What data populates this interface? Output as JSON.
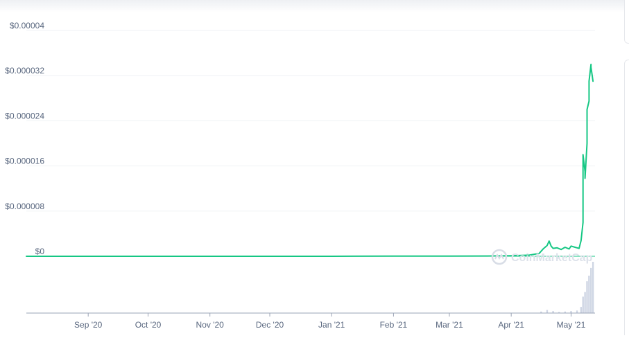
{
  "chart_data": {
    "type": "line",
    "watermark": "CoinMarketCap",
    "y_ticks": [
      "$0",
      "$0.000008",
      "$0.000016",
      "$0.000024",
      "$0.000032",
      "$0.00004"
    ],
    "y_tick_values": [
      0,
      8e-06,
      1.6e-05,
      2.4e-05,
      3.2e-05,
      4e-05
    ],
    "ylim": [
      0,
      4e-05
    ],
    "x_ticks": [
      {
        "label": "Sep '20",
        "date": "2020-09-01"
      },
      {
        "label": "Oct '20",
        "date": "2020-10-01"
      },
      {
        "label": "Nov '20",
        "date": "2020-11-01"
      },
      {
        "label": "Dec '20",
        "date": "2020-12-01"
      },
      {
        "label": "Jan '21",
        "date": "2021-01-01"
      },
      {
        "label": "Feb '21",
        "date": "2021-02-01"
      },
      {
        "label": "Mar '21",
        "date": "2021-03-01"
      },
      {
        "label": "Apr '21",
        "date": "2021-04-01"
      },
      {
        "label": "May '21",
        "date": "2021-05-01"
      }
    ],
    "xlim": [
      "2020-08-01",
      "2021-05-13"
    ],
    "grid": true,
    "colors": {
      "price_line": "#16c784",
      "volume": "#cfd6e4",
      "grid": "#eff2f5",
      "axis_text": "#58667e",
      "baseline": "#9aa3b5"
    },
    "series": [
      {
        "kind": "price",
        "x": [
          "2020-08-01",
          "2020-10-01",
          "2021-01-01",
          "2021-02-01",
          "2021-03-01",
          "2021-03-20",
          "2021-04-01",
          "2021-04-10",
          "2021-04-15",
          "2021-04-17",
          "2021-04-19",
          "2021-04-20",
          "2021-04-21",
          "2021-04-22",
          "2021-04-24",
          "2021-04-26",
          "2021-04-28",
          "2021-04-30",
          "2021-05-01",
          "2021-05-03",
          "2021-05-04",
          "2021-05-05",
          "2021-05-06",
          "2021-05-07",
          "2021-05-07",
          "2021-05-08",
          "2021-05-08",
          "2021-05-09",
          "2021-05-09",
          "2021-05-10",
          "2021-05-10",
          "2021-05-11",
          "2021-05-11",
          "2021-05-12"
        ],
        "y": [
          5e-10,
          1e-09,
          5e-09,
          2e-08,
          4e-08,
          5e-08,
          1e-07,
          2e-07,
          5e-07,
          1.3e-06,
          1.9e-06,
          2.7e-06,
          1.8e-06,
          1.4e-06,
          1.5e-06,
          1.2e-06,
          1.6e-06,
          1.3e-06,
          1.8e-06,
          1.6e-06,
          1.5e-06,
          1.4e-06,
          2.8e-06,
          6e-06,
          1.8e-05,
          1.5e-05,
          1.38e-05,
          2e-05,
          2.6e-05,
          2.75e-05,
          3.1e-05,
          3.4e-05,
          3.35e-05,
          3.1e-05
        ]
      },
      {
        "kind": "volume",
        "x": [
          "2021-04-16",
          "2021-04-19",
          "2021-04-22",
          "2021-04-25",
          "2021-04-28",
          "2021-05-01",
          "2021-05-04",
          "2021-05-06",
          "2021-05-07",
          "2021-05-08",
          "2021-05-09",
          "2021-05-10",
          "2021-05-11",
          "2021-05-12"
        ],
        "y": [
          0.03,
          0.06,
          0.04,
          0.02,
          0.03,
          0.04,
          0.05,
          0.12,
          0.32,
          0.41,
          0.62,
          0.73,
          0.88,
          1.0
        ]
      }
    ]
  }
}
